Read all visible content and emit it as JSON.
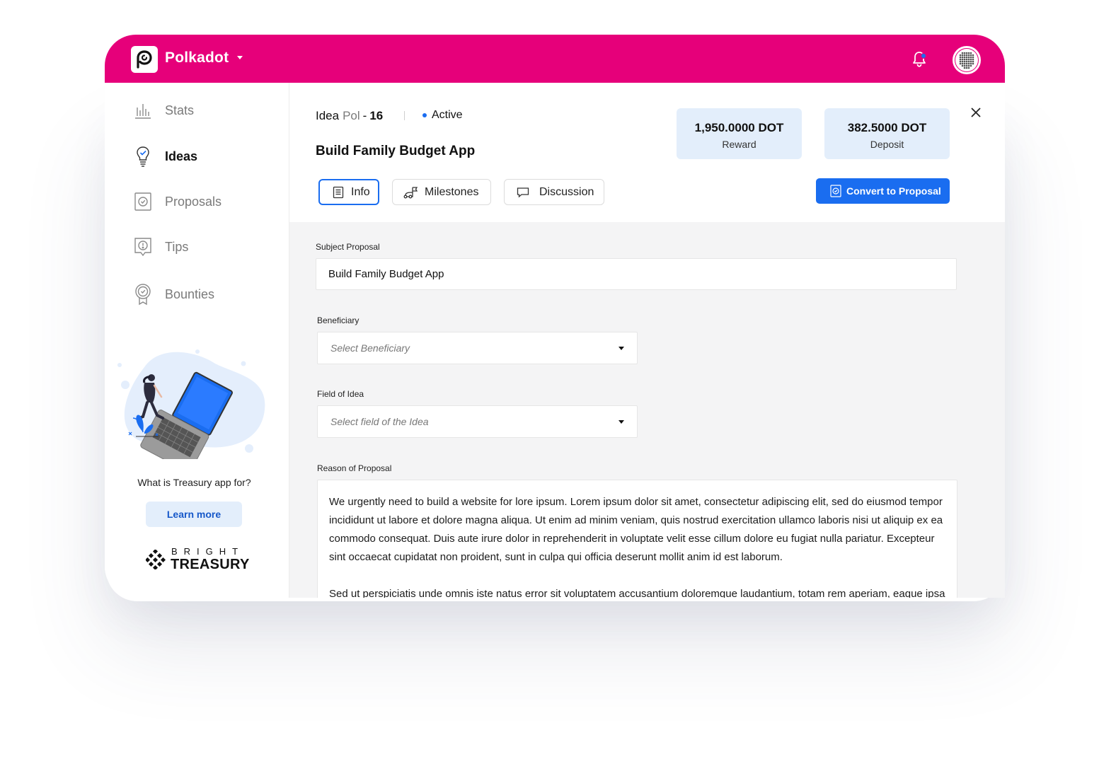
{
  "header": {
    "brand": "Polkadot",
    "accent_color": "#e6007a",
    "notification_icon": "bell-icon",
    "avatar_icon": "dotted-avatar-icon"
  },
  "sidebar": {
    "items": [
      {
        "label": "Stats",
        "icon": "stats-icon",
        "active": false
      },
      {
        "label": "Ideas",
        "icon": "lightbulb-icon",
        "active": true
      },
      {
        "label": "Proposals",
        "icon": "proposal-check-icon",
        "active": false
      },
      {
        "label": "Tips",
        "icon": "tip-exclamation-icon",
        "active": false
      },
      {
        "label": "Bounties",
        "icon": "bounty-badge-icon",
        "active": false
      }
    ],
    "promo_text": "What is Treasury app for?",
    "learn_more": "Learn more",
    "logo_top": "BRIGHT",
    "logo_bottom": "TREASURY"
  },
  "idea": {
    "prefix": "Idea",
    "network": "Pol",
    "dash": "-",
    "number": "16",
    "status": "Active",
    "title": "Build Family Budget App",
    "reward_value": "1,950.0000 DOT",
    "reward_label": "Reward",
    "deposit_value": "382.5000 DOT",
    "deposit_label": "Deposit"
  },
  "tabs": [
    {
      "label": "Info",
      "icon": "document-icon",
      "active": true
    },
    {
      "label": "Milestones",
      "icon": "milestones-icon",
      "active": false
    },
    {
      "label": "Discussion",
      "icon": "chat-bubble-icon",
      "active": false
    }
  ],
  "convert_button": "Convert to Proposal",
  "form": {
    "subject_label": "Subject Proposal",
    "subject_value": "Build Family Budget App",
    "beneficiary_label": "Beneficiary",
    "beneficiary_placeholder": "Select Beneficiary",
    "field_label": "Field of Idea",
    "field_placeholder": "Select field of the Idea",
    "reason_label": "Reason of Proposal",
    "reason_p1": "We urgently need to build a website for lore ipsum. Lorem ipsum dolor sit amet, consectetur adipiscing elit, sed do eiusmod tempor incididunt ut labore et dolore magna aliqua. Ut enim ad minim veniam, quis nostrud exercitation ullamco laboris nisi ut aliquip ex ea commodo consequat. Duis aute irure dolor in reprehenderit in voluptate velit esse cillum dolore eu fugiat nulla pariatur. Excepteur sint occaecat cupidatat non proident, sunt in culpa qui officia deserunt mollit anim id est laborum.",
    "reason_p2": "Sed ut perspiciatis unde omnis iste natus error sit voluptatem accusantium doloremque laudantium, totam rem aperiam, eaque ipsa quae ab illo inventore veritatis et quasi architecto beatae vitae dicta sunt explicabo."
  }
}
